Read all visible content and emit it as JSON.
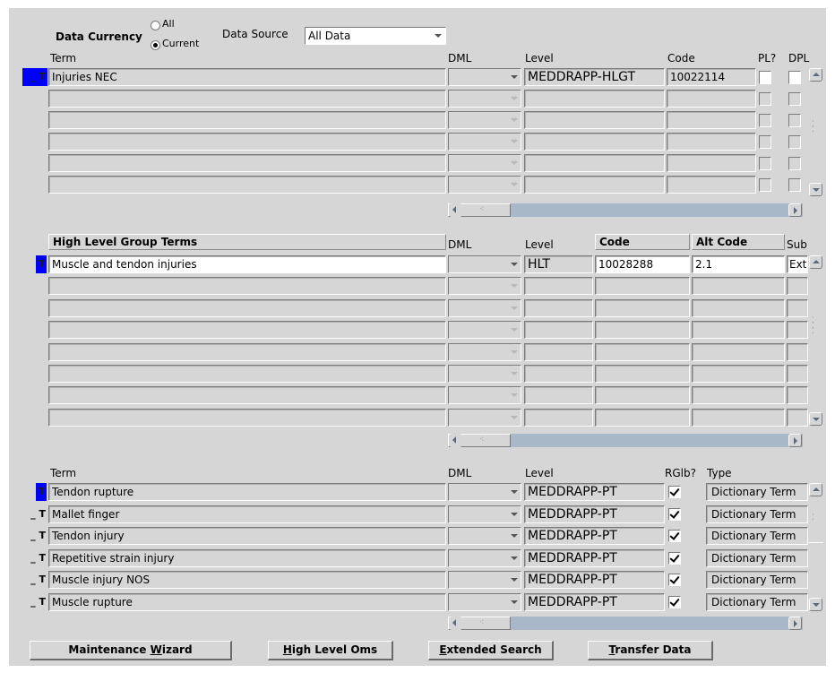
{
  "header": {
    "data_currency_label": "Data Currency",
    "radio_all": "All",
    "radio_current": "Current",
    "data_source_label": "Data Source",
    "data_source_value": "All Data"
  },
  "block1": {
    "col_term": "Term",
    "col_dml": "DML",
    "col_level": "Level",
    "col_code": "Code",
    "col_pl": "PL?",
    "col_dpl": "DPL",
    "row_indicator": "T",
    "row_prefix": "_",
    "rows": [
      {
        "term": "Injuries NEC",
        "level": "MEDDRAPP-HLGT",
        "code": "10022114"
      },
      {
        "term": "",
        "level": "",
        "code": ""
      },
      {
        "term": "",
        "level": "",
        "code": ""
      },
      {
        "term": "",
        "level": "",
        "code": ""
      },
      {
        "term": "",
        "level": "",
        "code": ""
      },
      {
        "term": "",
        "level": "",
        "code": ""
      }
    ]
  },
  "block2": {
    "col_term": "High Level Group Terms",
    "col_dml": "DML",
    "col_level": "Level",
    "col_code": "Code",
    "col_alt": "Alt Code",
    "col_sub": "Sub",
    "row_indicator": "T",
    "rows": [
      {
        "term": "Muscle and tendon injuries",
        "level": "HLT",
        "code": "10028288",
        "alt": "2.1",
        "sub": "Ext"
      }
    ]
  },
  "block3": {
    "col_term": "Term",
    "col_dml": "DML",
    "col_level": "Level",
    "col_rglb": "RGlb?",
    "col_type": "Type",
    "row_prefix": "_",
    "row_indicator": "T",
    "rows": [
      {
        "term": "Tendon rupture",
        "level": "MEDDRAPP-PT",
        "type": "Dictionary Term"
      },
      {
        "term": "Mallet finger",
        "level": "MEDDRAPP-PT",
        "type": "Dictionary Term"
      },
      {
        "term": "Tendon injury",
        "level": "MEDDRAPP-PT",
        "type": "Dictionary Term"
      },
      {
        "term": "Repetitive strain injury",
        "level": "MEDDRAPP-PT",
        "type": "Dictionary Term"
      },
      {
        "term": "Muscle injury NOS",
        "level": "MEDDRAPP-PT",
        "type": "Dictionary Term"
      },
      {
        "term": "Muscle rupture",
        "level": "MEDDRAPP-PT",
        "type": "Dictionary Term"
      }
    ]
  },
  "buttons": {
    "maintenance": {
      "pre": "Maintenance ",
      "u": "W",
      "post": "izard"
    },
    "high_level": {
      "pre": "",
      "u": "H",
      "post": "igh Level Oms"
    },
    "extended": {
      "pre": "",
      "u": "E",
      "post": "xtended Search"
    },
    "transfer": {
      "pre": "",
      "u": "T",
      "post": "ransfer Data"
    }
  },
  "icons": {
    "scroll_up": "scroll-up-arrow-icon",
    "scroll_down": "scroll-down-arrow-icon",
    "scroll_left": "scroll-left-arrow-icon",
    "scroll_right": "scroll-right-arrow-icon",
    "dropdown": "dropdown-arrow-icon"
  },
  "colors": {
    "panel": "#d6d6d6",
    "record_indicator": "#0000ff"
  }
}
